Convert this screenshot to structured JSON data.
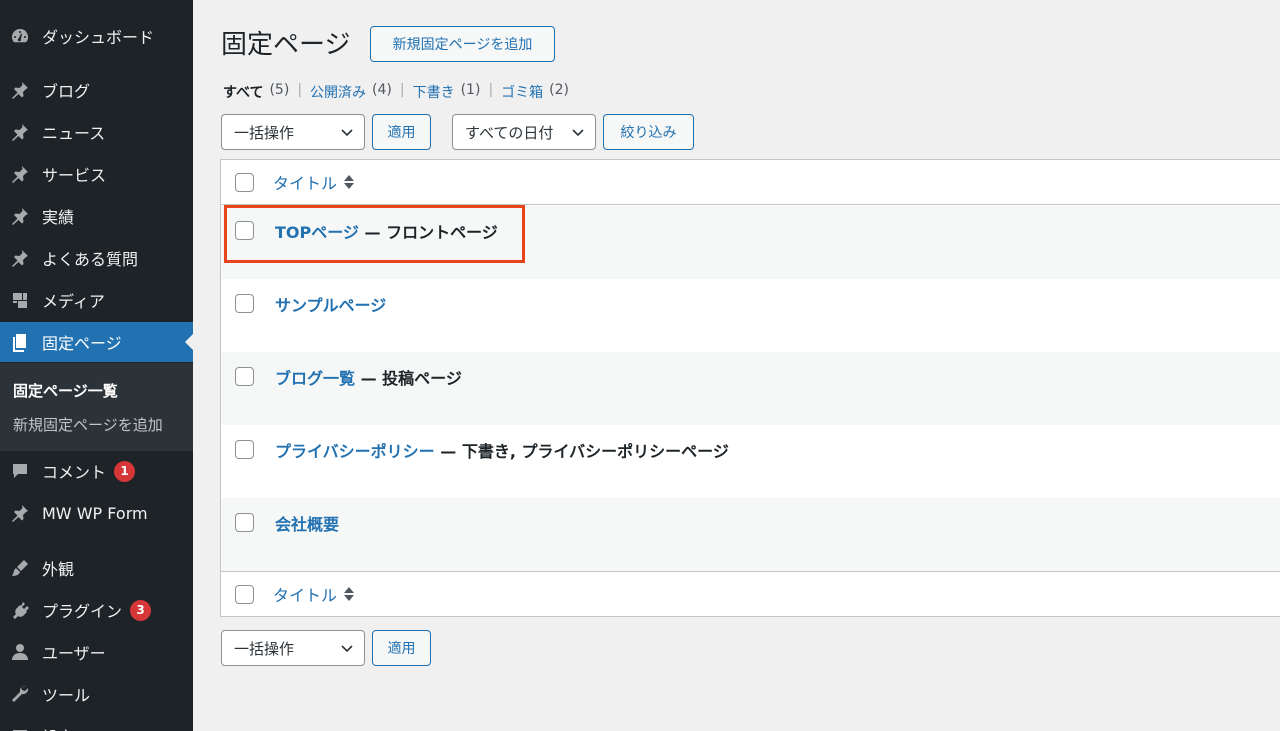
{
  "sidebar": {
    "items": [
      {
        "label": "ダッシュボード",
        "icon": "dashboard-icon"
      },
      {
        "label": "ブログ",
        "icon": "pin-icon"
      },
      {
        "label": "ニュース",
        "icon": "pin-icon"
      },
      {
        "label": "サービス",
        "icon": "pin-icon"
      },
      {
        "label": "実績",
        "icon": "pin-icon"
      },
      {
        "label": "よくある質問",
        "icon": "pin-icon"
      },
      {
        "label": "メディア",
        "icon": "media-icon"
      },
      {
        "label": "固定ページ",
        "icon": "pages-icon"
      },
      {
        "label": "コメント",
        "icon": "comment-icon",
        "badge": "1"
      },
      {
        "label": "MW WP Form",
        "icon": "pin-icon"
      },
      {
        "label": "外観",
        "icon": "brush-icon"
      },
      {
        "label": "プラグイン",
        "icon": "plugin-icon",
        "badge": "3"
      },
      {
        "label": "ユーザー",
        "icon": "user-icon"
      },
      {
        "label": "ツール",
        "icon": "wrench-icon"
      },
      {
        "label": "設定",
        "icon": "settings-icon"
      }
    ],
    "submenu": [
      {
        "label": "固定ページ一覧"
      },
      {
        "label": "新規固定ページを追加"
      }
    ]
  },
  "header": {
    "title": "固定ページ",
    "add_new": "新規固定ページを追加"
  },
  "filters": {
    "all": "すべて",
    "all_count": "(5)",
    "published": "公開済み",
    "published_count": "(4)",
    "draft": "下書き",
    "draft_count": "(1)",
    "trash": "ゴミ箱",
    "trash_count": "(2)",
    "separator": "|"
  },
  "toolbar": {
    "bulk_action": "一括操作",
    "apply": "適用",
    "date_filter": "すべての日付",
    "filter": "絞り込み"
  },
  "table": {
    "column_title": "タイトル",
    "rows": [
      {
        "title": "TOPページ",
        "state": " — フロントページ"
      },
      {
        "title": "サンプルページ",
        "state": ""
      },
      {
        "title": "ブログ一覧",
        "state": " — 投稿ページ"
      },
      {
        "title": "プライバシーポリシー",
        "state": " — 下書き, プライバシーポリシーページ"
      },
      {
        "title": "会社概要",
        "state": ""
      }
    ]
  },
  "colors": {
    "sidebar_bg": "#1d2327",
    "accent": "#2271b1",
    "highlight": "#e8451d",
    "badge": "#d63638"
  }
}
